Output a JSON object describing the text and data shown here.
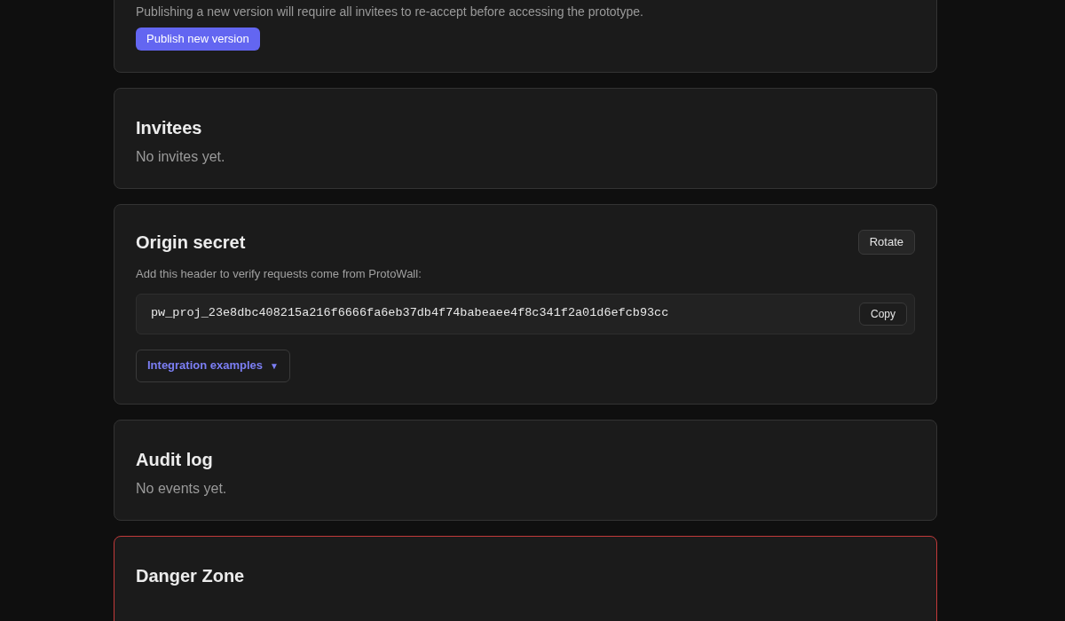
{
  "publish": {
    "description": "Publishing a new version will require all invitees to re-accept before accessing the prototype.",
    "button": "Publish new version"
  },
  "invitees": {
    "title": "Invitees",
    "empty": "No invites yet."
  },
  "origin_secret": {
    "title": "Origin secret",
    "rotate_button": "Rotate",
    "hint": "Add this header to verify requests come from ProtoWall:",
    "secret": "pw_proj_23e8dbc408215a216f6666fa6eb37db4f74babeaee4f8c341f2a01d6efcb93cc",
    "copy_button": "Copy",
    "integration": {
      "label": "Integration examples",
      "caret": "▼",
      "expanded": false
    }
  },
  "audit_log": {
    "title": "Audit log",
    "empty": "No events yet."
  },
  "danger_zone": {
    "title": "Danger Zone"
  }
}
